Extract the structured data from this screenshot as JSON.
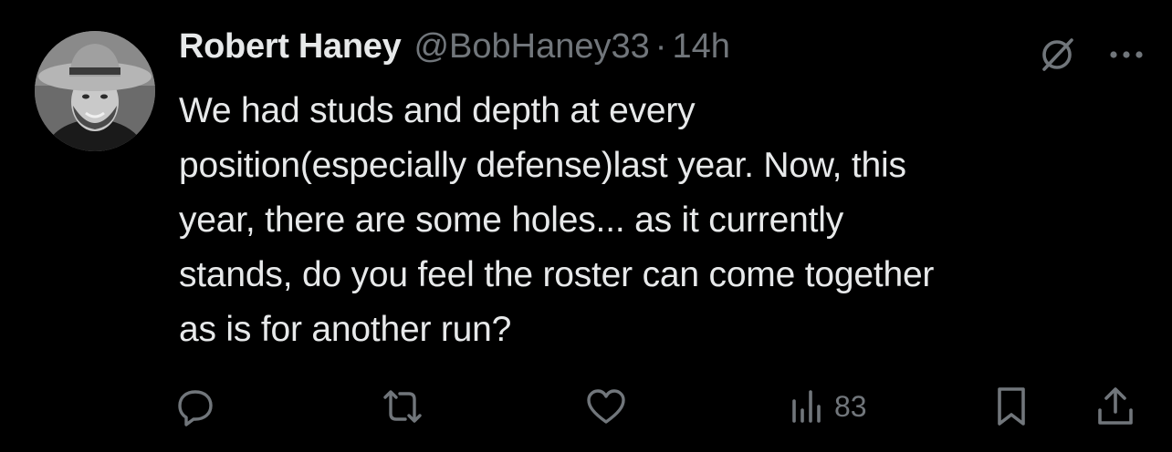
{
  "author": {
    "display_name": "Robert Haney",
    "handle": "@BobHaney33",
    "separator": "·",
    "time": "14h"
  },
  "tweet": {
    "text": "We had studs and depth at every\nposition(especially defense)last year. Now, this\nyear, there are some holes... as it currently\nstands, do you feel the roster can come together\nas is for another run?"
  },
  "actions": {
    "reply_icon": "reply-icon",
    "retweet_icon": "retweet-icon",
    "like_icon": "heart-icon",
    "views_icon": "views-icon",
    "views_count": "83",
    "bookmark_icon": "bookmark-icon",
    "share_icon": "share-icon"
  },
  "top_icons": [
    "grok-icon",
    "more-icon"
  ],
  "colors": {
    "background": "#000000",
    "primary_text": "#e7e9ea",
    "secondary_text": "#71767b"
  }
}
